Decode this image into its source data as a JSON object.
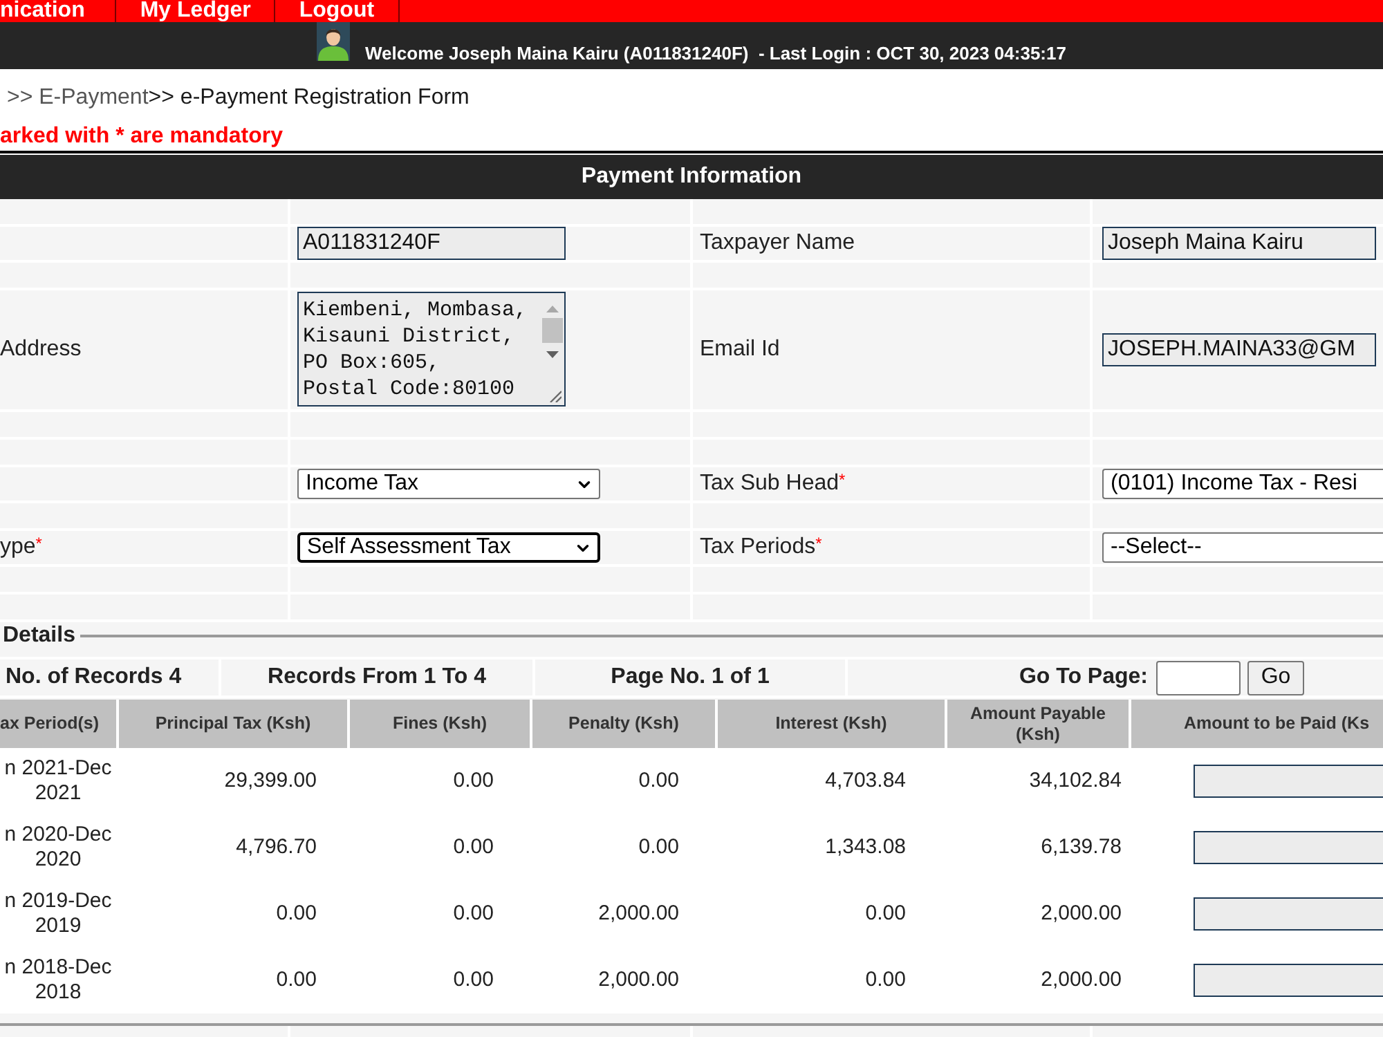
{
  "top_nav": [
    {
      "label": "nication"
    },
    {
      "label": "My Ledger"
    },
    {
      "label": "Logout"
    }
  ],
  "user_bar": {
    "welcome": "Welcome Joseph Maina Kairu (A011831240F)  - Last Login : OCT 30, 2023 04:35:17"
  },
  "breadcrumb": [
    {
      "text": ">> E-Payment",
      "kind": "link"
    },
    {
      "text": ">> e-Payment Registration Form",
      "kind": "current"
    }
  ],
  "mandatory_note": "arked with * are mandatory",
  "section_title": "Payment Information",
  "form_groups": [
    {
      "rows": [
        {
          "left": {
            "field": {
              "kind": "text",
              "value": "A011831240F",
              "readonly": true
            }
          },
          "right": {
            "label": "Taxpayer Name",
            "field": {
              "kind": "text",
              "value": "Joseph Maina Kairu",
              "readonly": true
            }
          }
        },
        {
          "left": {
            "label": "Address",
            "field": {
              "kind": "textarea",
              "value": "Kiembeni, Mombasa,\nKisauni District,\nPO Box:605,\nPostal Code:80100",
              "readonly": true
            }
          },
          "right": {
            "label": "Email Id",
            "field": {
              "kind": "text",
              "value": "JOSEPH.MAINA33@GM",
              "readonly": true
            }
          }
        }
      ]
    },
    {
      "rows": [
        {
          "left": {
            "field": {
              "kind": "select",
              "value": "Income Tax",
              "focused": false
            }
          },
          "right": {
            "label": "Tax Sub Head",
            "required_mark": "*",
            "field": {
              "kind": "select",
              "value": "(0101) Income Tax - Resi",
              "focused": false
            }
          }
        },
        {
          "left": {
            "label": "ype",
            "required_mark": "*",
            "field": {
              "kind": "select",
              "value": "Self Assessment Tax",
              "focused": true
            }
          },
          "right": {
            "label": "Tax Periods",
            "required_mark": "*",
            "field": {
              "kind": "select",
              "value": "--Select--",
              "focused": false
            }
          }
        }
      ]
    }
  ],
  "details": {
    "legend": "Details",
    "pager": {
      "record_count": "No. of Records 4",
      "record_range": "Records From 1 To 4",
      "page_number": "Page No. 1 of 1",
      "goto_label": "Go To Page:",
      "goto_button": "Go"
    },
    "table": {
      "columns": [
        "ax Period(s)",
        "Principal Tax (Ksh)",
        "Fines (Ksh)",
        "Penalty (Ksh)",
        "Interest (Ksh)",
        "Amount Payable (Ksh)",
        "Amount to be Paid (Ks"
      ],
      "rows": [
        {
          "cells": [
            "n 2021-Dec 2021",
            "29,399.00",
            "0.00",
            "0.00",
            "4,703.84",
            "34,102.84"
          ],
          "amount_field": {
            "readonly": true
          }
        },
        {
          "cells": [
            "n 2020-Dec 2020",
            "4,796.70",
            "0.00",
            "0.00",
            "1,343.08",
            "6,139.78"
          ],
          "amount_field": {
            "readonly": true
          }
        },
        {
          "cells": [
            "n 2019-Dec 2019",
            "0.00",
            "0.00",
            "2,000.00",
            "0.00",
            "2,000.00"
          ],
          "amount_field": {
            "readonly": true
          }
        },
        {
          "cells": [
            "n 2018-Dec 2018",
            "0.00",
            "0.00",
            "2,000.00",
            "0.00",
            "2,000.00"
          ],
          "amount_field": {
            "readonly": true
          }
        }
      ]
    }
  }
}
